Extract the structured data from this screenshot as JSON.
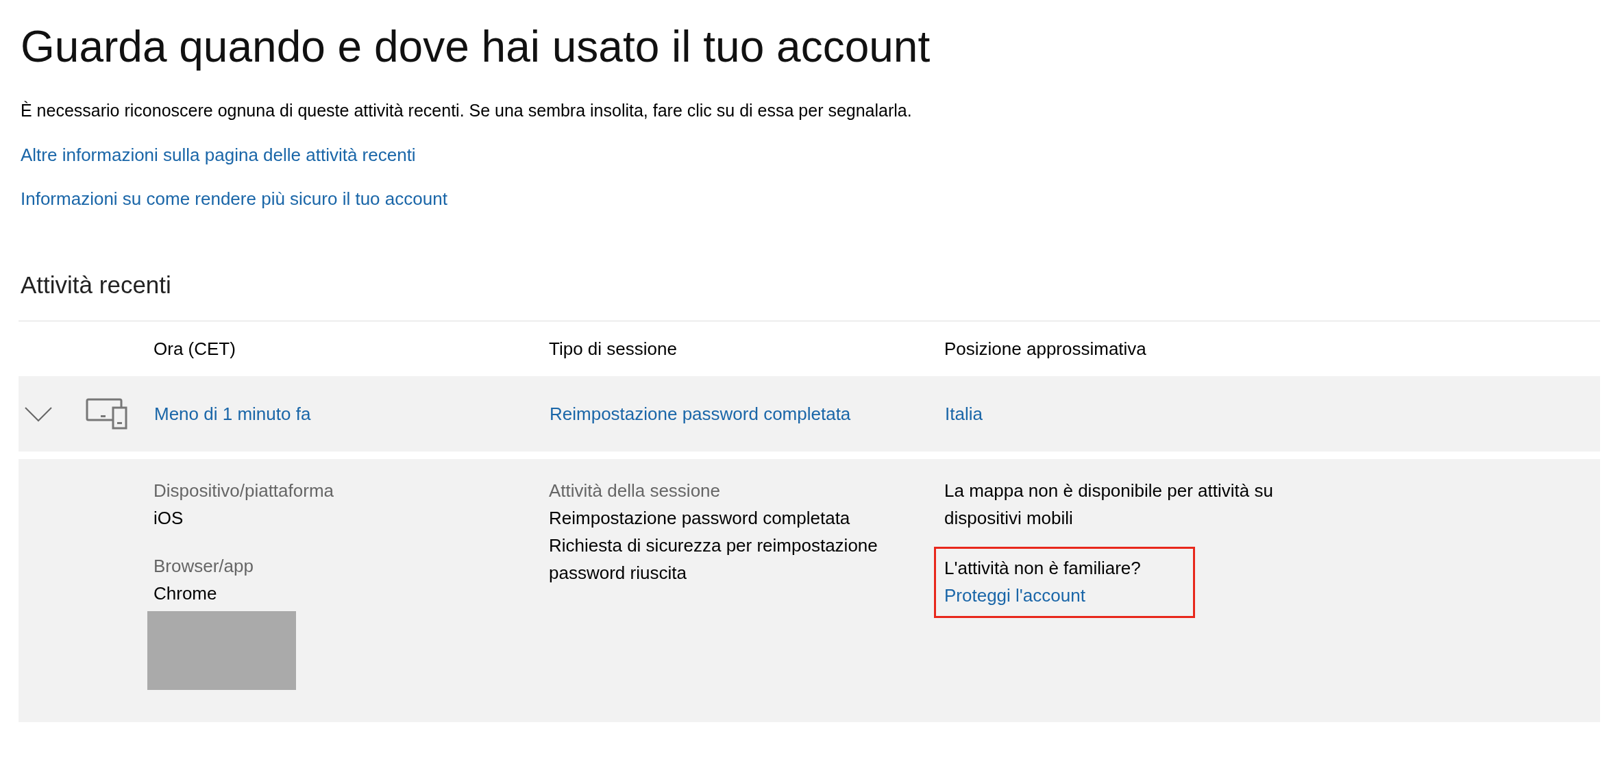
{
  "title": "Guarda quando e dove hai usato il tuo account",
  "intro": "È necessario riconoscere ognuna di queste attività recenti. Se una sembra insolita, fare clic su di essa per segnalarla.",
  "links": [
    "Altre informazioni sulla pagina delle attività recenti",
    "Informazioni su come rendere più sicuro il tuo account"
  ],
  "section_title": "Attività recenti",
  "table": {
    "columns": [
      "Ora (CET)",
      "Tipo di sessione",
      "Posizione approssimativa"
    ],
    "rows": [
      {
        "expanded": true,
        "time": "Meno di 1 minuto fa",
        "session_type": "Reimpostazione password completata",
        "location": "Italia",
        "details": {
          "device_label": "Dispositivo/piattaforma",
          "device_value": "iOS",
          "browser_label": "Browser/app",
          "browser_value": "Chrome",
          "activity_label": "Attività della sessione",
          "activity_items": [
            "Reimpostazione password completata",
            "Richiesta di sicurezza per reimpostazione password riuscita"
          ],
          "map_note": "La mappa non è disponibile per attività su dispositivi mobili",
          "unfamiliar": {
            "question": "L'attività non è familiare?",
            "link": "Proteggi l'account"
          }
        }
      }
    ]
  }
}
